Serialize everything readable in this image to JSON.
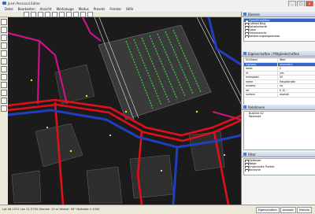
{
  "window": {
    "title": "Josm Personal Editor",
    "minimize": "_",
    "maximize": "□",
    "close": "x"
  },
  "menu": [
    "Datei",
    "Bearbeiten",
    "Ansicht",
    "Werkzeuge",
    "Modus",
    "Presets",
    "Fenster",
    "Hilfe"
  ],
  "layers_panel": {
    "title": "Ebenen",
    "items": [
      {
        "label": "OpenStreetMap",
        "selected": true
      },
      {
        "label": "Luftbild Bing",
        "selected": false
      },
      {
        "label": "Katasterkarte",
        "selected": false
      },
      {
        "label": "Fotos",
        "selected": false
      },
      {
        "label": "Fehlerbericht",
        "selected": false
      },
      {
        "label": "Validierungsergebnisse",
        "selected": false
      }
    ]
  },
  "tags_panel": {
    "title": "Eigenschaften / Mitgliedschaften",
    "header_key": "Schlüssel",
    "header_value": "Wert",
    "rows": [
      {
        "key": "highway",
        "value": "secondary",
        "selected": true
      },
      {
        "key": "lanes",
        "value": "2",
        "selected": false
      },
      {
        "key": "lit",
        "value": "yes",
        "selected": false
      },
      {
        "key": "maxspeed",
        "value": "50",
        "selected": false
      },
      {
        "key": "name",
        "value": "Hauptstraße",
        "selected": false
      },
      {
        "key": "oneway",
        "value": "no",
        "selected": false
      },
      {
        "key": "ref",
        "value": "K 12",
        "selected": false
      },
      {
        "key": "surface",
        "value": "asphalt",
        "selected": false
      }
    ]
  },
  "relations_panel": {
    "title": "Relationen",
    "rows": [
      {
        "label": "Buslinie 42"
      },
      {
        "label": "Radroute"
      }
    ]
  },
  "filter_panel": {
    "title": "Filter",
    "rows": [
      {
        "label": "Gebäude"
      },
      {
        "label": "Wege"
      },
      {
        "label": "Ungenutzte Punkte"
      },
      {
        "label": "Bereiche"
      }
    ]
  },
  "status": {
    "text": "Lat 48.1372  Lon 11.5755  Strecke: 12 m  Winkel: 90°  Maßstab 1:1000",
    "tabs": [
      "Eigenschaften",
      "Auswahl",
      "Historie"
    ]
  },
  "colors": {
    "map_bg": "#1a1a1a",
    "building_fill": "#3a3a3a",
    "road_primary": "#e0101a",
    "road_secondary": "#c71585",
    "road_motorway": "#1f3fbf",
    "rail": "#d0d0d0",
    "tree_rows": "#39d639",
    "selection": "#3366cc"
  }
}
